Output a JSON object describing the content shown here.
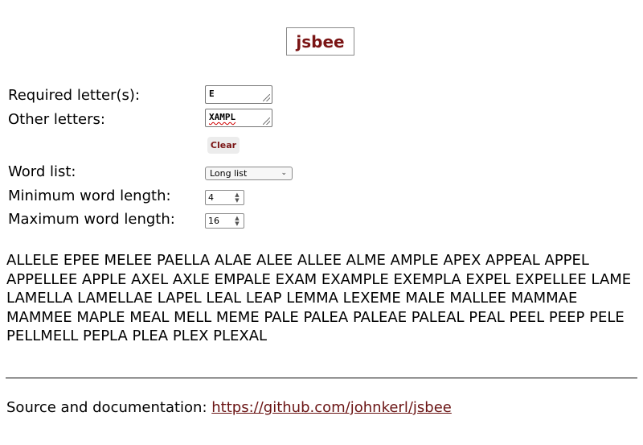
{
  "header": {
    "title": "jsbee"
  },
  "form": {
    "required_label": "Required letter(s):",
    "required_value": "E",
    "other_label": "Other letters:",
    "other_value": "XAMPL",
    "clear_label": "Clear",
    "wordlist_label": "Word list:",
    "wordlist_selected": "Long list",
    "min_label": "Minimum word length:",
    "min_value": "4",
    "max_label": "Maximum word length:",
    "max_value": "16"
  },
  "results": {
    "words": "ALLELE EPEE MELEE PAELLA ALAE ALEE ALLEE ALME AMPLE APEX APPEAL APPEL APPELLEE APPLE AXEL AXLE EMPALE EXAM EXAMPLE EXEMPLA EXPEL EXPELLEE LAME LAMELLA LAMELLAE LAPEL LEAL LEAP LEMMA LEXEME MALE MALLEE MAMMAE MAMMEE MAPLE MEAL MELL MEME PALE PALEA PALEAE PALEAL PEAL PEEL PEEP PELE PELLMELL PEPLA PLEA PLEX PLEXAL"
  },
  "footer": {
    "source_label": "Source and documentation:",
    "source_link": "https://github.com/johnkerl/jsbee"
  },
  "colors": {
    "accent": "#7a1414",
    "link": "#6b1515"
  }
}
